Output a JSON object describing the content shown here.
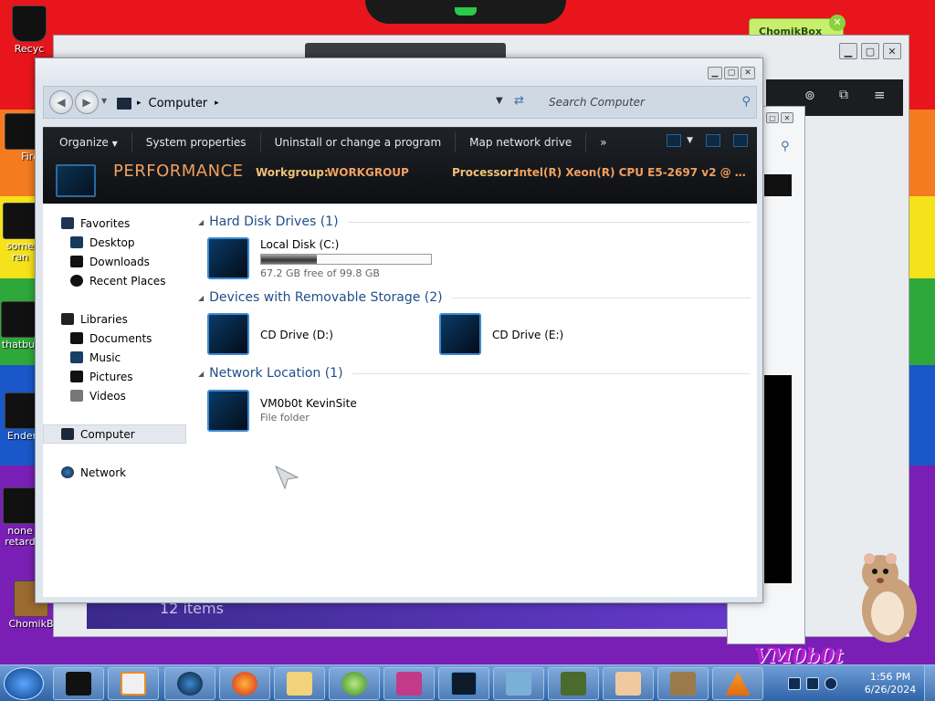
{
  "desktop": {
    "icons": [
      {
        "label": "Recyc",
        "name": "recycle-bin"
      },
      {
        "label": "Fire",
        "name": "firefox-shortcut"
      },
      {
        "label": "some\nran",
        "name": "some-ran-shortcut"
      },
      {
        "label": "thatbu",
        "name": "thatbu-shortcut"
      },
      {
        "label": "Ender",
        "name": "ender-shortcut"
      },
      {
        "label": "none\nretard",
        "name": "none-retard-shortcut"
      },
      {
        "label": "ChomikB",
        "name": "chomikbox-shortcut"
      }
    ],
    "chomikbox_badge": "ChomikBox",
    "background_windows_status": "12 items",
    "signature": "VM0b0t"
  },
  "explorer": {
    "address": {
      "path": "Computer",
      "search_placeholder": "Search Computer"
    },
    "commands": {
      "organize": "Organize",
      "system_properties": "System properties",
      "uninstall": "Uninstall or change a program",
      "map_drive": "Map network drive",
      "more": "»"
    },
    "details": {
      "computer_name": "PERFORMANCE",
      "workgroup_label": "Workgroup:",
      "workgroup_value": "WORKGROUP",
      "processor_label": "Processor:",
      "processor_value": "Intel(R) Xeon(R) CPU E5-2697 v2 @ 2.7..."
    },
    "nav": {
      "favorites": "Favorites",
      "desktop": "Desktop",
      "downloads": "Downloads",
      "recent": "Recent Places",
      "libraries": "Libraries",
      "documents": "Documents",
      "music": "Music",
      "pictures": "Pictures",
      "videos": "Videos",
      "computer": "Computer",
      "network": "Network"
    },
    "groups": {
      "hdd": "Hard Disk Drives (1)",
      "removable": "Devices with Removable Storage (2)",
      "network": "Network Location (1)"
    },
    "drives": {
      "c_name": "Local Disk (C:)",
      "c_free": "67.2 GB free of 99.8 GB",
      "c_used_fraction": 0.327,
      "d_name": "CD Drive (D:)",
      "e_name": "CD Drive (E:)",
      "net_name": "VM0b0t KevinSite",
      "net_type": "File folder"
    }
  },
  "taskbar": {
    "time": "1:56 PM",
    "date": "6/26/2024"
  },
  "colors": {
    "accent_orange": "#f0a060",
    "group_header_blue": "#1f4e8a"
  }
}
